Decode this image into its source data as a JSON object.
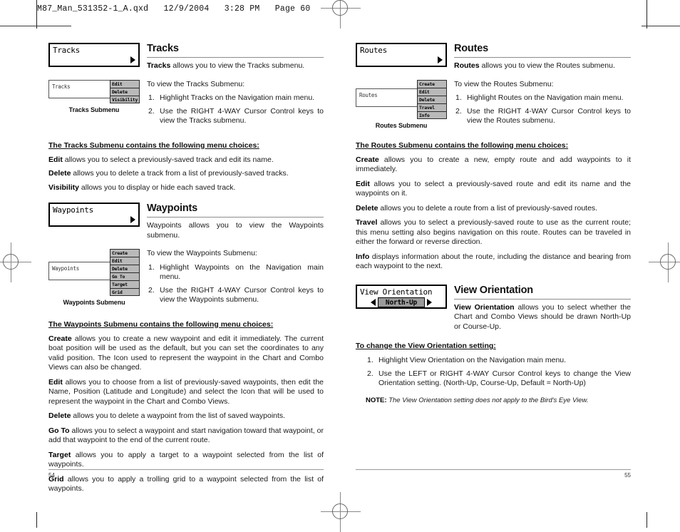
{
  "slug": "M87_Man_531352-1_A.qxd   12/9/2004   3:28 PM   Page 60",
  "left_page": {
    "page_number": "54",
    "sections": [
      {
        "lcd_label": "Tracks",
        "title": "Tracks",
        "lede_bold": "Tracks",
        "lede_rest": " allows you to view the Tracks submenu.",
        "art": {
          "base_label": "Tracks",
          "submenu_items": [
            "Edit",
            "Delete",
            "Visibility"
          ],
          "caption": "Tracks Submenu"
        },
        "intro": "To view the Tracks Submenu:",
        "steps": [
          "Highlight Tracks on the Navigation main menu.",
          "Use the RIGHT 4-WAY Cursor Control keys to view the Tracks submenu."
        ],
        "choices_head": "The Tracks Submenu contains the following menu choices:",
        "choices": [
          {
            "term": "Edit",
            "desc": " allows you to select a previously-saved track and edit its name."
          },
          {
            "term": "Delete",
            "desc": " allows you to delete a track from a list of previously-saved tracks."
          },
          {
            "term": "Visibility",
            "desc": " allows you to display or hide each saved track."
          }
        ]
      },
      {
        "lcd_label": "Waypoints",
        "title": "Waypoints",
        "lede_bold": "",
        "lede_rest": "Waypoints allows you to view the Waypoints submenu.",
        "art": {
          "base_label": "Waypoints",
          "submenu_items": [
            "Create",
            "Edit",
            "Delete",
            "Go To",
            "Target",
            "Grid"
          ],
          "caption": "Waypoints Submenu"
        },
        "intro": "To view the Waypoints Submenu:",
        "steps": [
          "Highlight Waypoints on the Navigation main menu.",
          "Use the RIGHT 4-WAY Cursor Control keys to view the Waypoints submenu."
        ],
        "choices_head": "The Waypoints Submenu contains the following menu choices:",
        "choices": [
          {
            "term": "Create",
            "desc": " allows you to create a new waypoint and edit it immediately.  The current boat position will be used as the default, but you can set the coordinates to any valid position. The Icon used to represent the waypoint in the Chart and Combo Views can also be changed."
          },
          {
            "term": "Edit",
            "desc": " allows you to choose from a list of previously-saved waypoints, then edit the Name, Position (Latitude and Longitude) and select the Icon that will be used to represent the waypoint in the Chart and Combo Views."
          },
          {
            "term": "Delete",
            "desc": " allows you to delete a waypoint from the list of saved waypoints."
          },
          {
            "term": "Go To",
            "desc": " allows you to select a waypoint and start navigation toward that waypoint, or add that waypoint to the end of the current route."
          },
          {
            "term": "Target",
            "desc": " allows you to apply a target to a waypoint selected from the list of waypoints."
          },
          {
            "term": "Grid",
            "desc": " allows you to apply a trolling grid to a waypoint selected from the list of waypoints."
          }
        ]
      }
    ]
  },
  "right_page": {
    "page_number": "55",
    "sections": [
      {
        "lcd_label": "Routes",
        "title": "Routes",
        "lede_bold": "Routes",
        "lede_rest": " allows you to view the Routes submenu.",
        "art": {
          "base_label": "Routes",
          "submenu_items": [
            "Create",
            "Edit",
            "Delete",
            "Travel",
            "Info"
          ],
          "caption": "Routes Submenu"
        },
        "intro": "To view the Routes Submenu:",
        "steps": [
          "Highlight Routes on the Navigation main menu.",
          "Use the RIGHT 4-WAY Cursor Control keys to view the Routes submenu."
        ],
        "choices_head": "The Routes Submenu contains the following menu choices:",
        "choices": [
          {
            "term": "Create",
            "desc": " allows you to create a new, empty route and add waypoints to it immediately."
          },
          {
            "term": "Edit",
            "desc": " allows you to select a previously-saved route and edit its name and the waypoints on it."
          },
          {
            "term": "Delete",
            "desc": " allows you to delete a route from a list of previously-saved routes."
          },
          {
            "term": "Travel",
            "desc": " allows you to select a previously-saved route to use as the current route; this menu setting also begins navigation on this route. Routes can be traveled in either the forward or reverse direction."
          },
          {
            "term": "Info",
            "desc": " displays information about the route, including the distance and bearing from each waypoint to the next."
          }
        ]
      }
    ],
    "view_orientation": {
      "lcd_label": "View Orientation",
      "lcd_value": "North-Up",
      "title": "View Orientation",
      "lede_bold": "View Orientation",
      "lede_rest": " allows you to select whether the Chart and Combo Views should be drawn North-Up or Course-Up.",
      "change_head": "To change the View Orientation setting:",
      "steps": [
        "Highlight View Orientation on the Navigation main menu.",
        "Use the LEFT or RIGHT 4-WAY Cursor Control keys to change the View Orientation setting. (North-Up, Course-Up, Default = North-Up)"
      ],
      "note_label": "NOTE:",
      "note_text": "The View Orientation setting does not apply to the Bird's Eye View."
    }
  }
}
